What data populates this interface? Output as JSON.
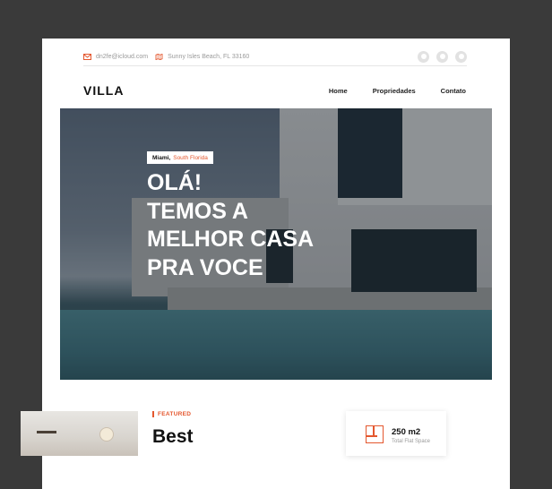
{
  "topbar": {
    "email": "dn2fe@icloud.com",
    "address": "Sunny Isles Beach, FL 33160",
    "email_icon": "mail-icon",
    "address_icon": "map-icon",
    "social_icons": [
      "facebook-icon",
      "github-icon",
      "linkedin-icon"
    ]
  },
  "nav": {
    "logo": "VILLA",
    "items": [
      "Home",
      "Propriedades",
      "Contato"
    ]
  },
  "hero": {
    "city": "Miami,",
    "region": "South Florida",
    "headline": [
      "OLÁ!",
      "TEMOS A",
      "MELHOR CASA",
      "PRA VOCE"
    ]
  },
  "listing": {
    "tag": "FEATURED",
    "title": "Best",
    "area_value": "250 m2",
    "area_label": "Total Flat Space",
    "area_icon": "floorplan-icon"
  },
  "colors": {
    "accent": "#e4572e",
    "background": "#3a3a3a",
    "page": "#ffffff"
  }
}
